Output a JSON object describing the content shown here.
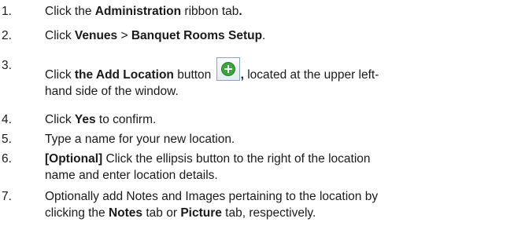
{
  "steps": [
    {
      "number": "1.",
      "parts": [
        "Click the ",
        "Administration",
        " ribbon tab",
        "."
      ]
    },
    {
      "number": "2.",
      "parts": [
        "Click ",
        "Venues",
        " > ",
        "Banquet Rooms Setup",
        "."
      ]
    },
    {
      "number": "3.",
      "parts": [
        "Click ",
        "the Add Location",
        " button ",
        ",",
        " located at the upper left-"
      ],
      "line2": "hand side of the window.",
      "icon": "add-location-icon"
    },
    {
      "number": "4.",
      "parts": [
        "Click ",
        "Yes",
        " to confirm."
      ]
    },
    {
      "number": "5.",
      "parts": [
        "Type a name for your new location."
      ]
    },
    {
      "number": "6.",
      "parts": [
        "[Optional]",
        " Click the ellipsis button to the right of the location"
      ],
      "line2": "name and enter location details."
    },
    {
      "number": "7.",
      "parts": [
        "Optionally add Notes and Images pertaining to the location by"
      ],
      "line2_parts": [
        "clicking the ",
        "Notes",
        " tab or ",
        "Picture",
        " tab, respectively."
      ]
    }
  ],
  "colors": {
    "text": "#1a1a1a",
    "icon_green": "#3da53d",
    "icon_border": "#8aa4c4"
  }
}
